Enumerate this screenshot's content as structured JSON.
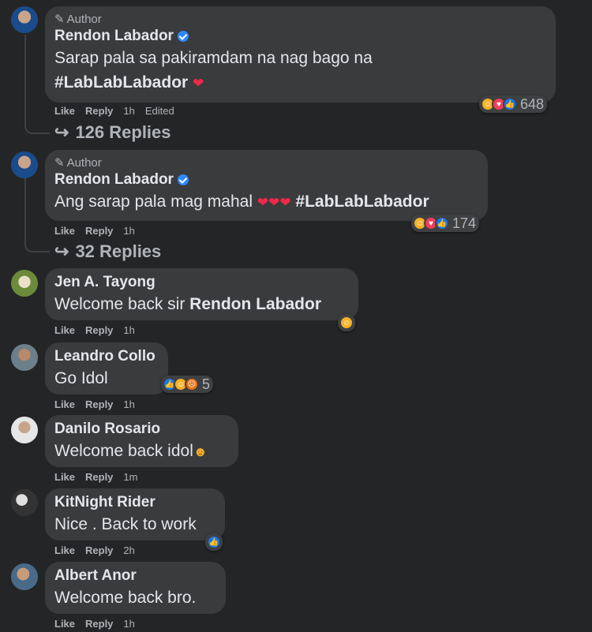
{
  "comments": [
    {
      "author_tag": "Author",
      "name": "Rendon Labador",
      "verified": true,
      "text_line1": "Sarap pala sa pakiramdam na nag bago na",
      "text_line2_hashtag": "#LabLabLabador",
      "like": "Like",
      "reply": "Reply",
      "time": "1h",
      "edited": "Edited",
      "reactions": [
        "haha",
        "love",
        "like"
      ],
      "reaction_count": "648",
      "replies_label": "126 Replies"
    },
    {
      "author_tag": "Author",
      "name": "Rendon Labador",
      "verified": true,
      "text_prefix": "Ang sarap pala mag mahal",
      "text_hashtag": "#LabLabLabador",
      "like": "Like",
      "reply": "Reply",
      "time": "1h",
      "reactions": [
        "haha",
        "love",
        "like"
      ],
      "reaction_count": "174",
      "replies_label": "32 Replies"
    },
    {
      "name": "Jen A. Tayong",
      "text_prefix": "Welcome back sir",
      "text_bold": "Rendon Labador",
      "like": "Like",
      "reply": "Reply",
      "time": "1h",
      "reactions": [
        "haha"
      ]
    },
    {
      "name": "Leandro Collo",
      "text": "Go Idol",
      "like": "Like",
      "reply": "Reply",
      "time": "1h",
      "reactions": [
        "like",
        "haha",
        "angry"
      ],
      "reaction_count": "5"
    },
    {
      "name": "Danilo Rosario",
      "text": "Welcome back idol",
      "like": "Like",
      "reply": "Reply",
      "time": "1m"
    },
    {
      "name": "KitNight Rider",
      "text": "Nice . Back to work",
      "like": "Like",
      "reply": "Reply",
      "time": "2h",
      "reactions": [
        "like"
      ]
    },
    {
      "name": "Albert Anor",
      "text": "Welcome back bro.",
      "like": "Like",
      "reply": "Reply",
      "time": "1h"
    }
  ],
  "colors": {
    "background": "#242526",
    "bubble": "#3a3b3c",
    "verified": "#2d88ff",
    "like": "#1877f2",
    "love": "#f33e58",
    "haha": "#f7b125",
    "angry": "#e9710f"
  }
}
